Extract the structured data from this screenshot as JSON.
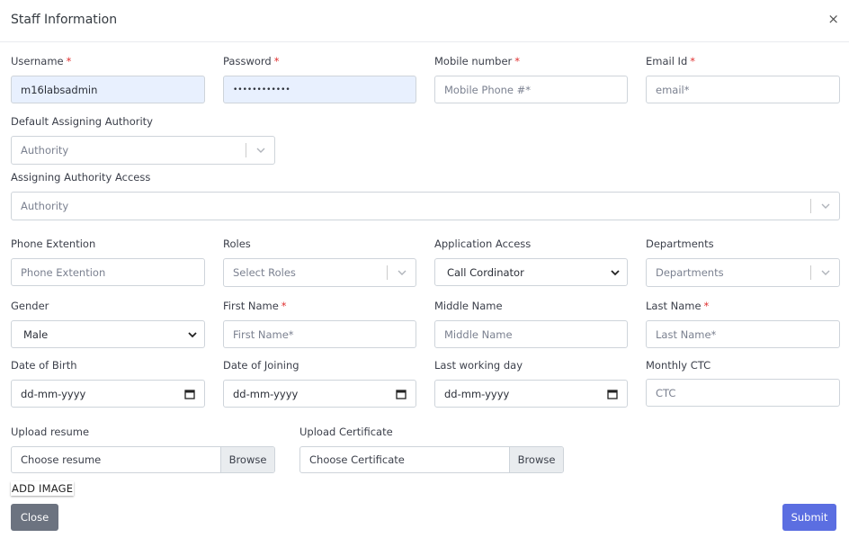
{
  "modal": {
    "title": "Staff Information",
    "close_glyph": "×"
  },
  "fields": {
    "username": {
      "label": "Username",
      "value": "m16labsadmin"
    },
    "password": {
      "label": "Password",
      "value": "••••••••••••"
    },
    "mobile": {
      "label": "Mobile number",
      "placeholder": "Mobile Phone #*"
    },
    "email": {
      "label": "Email Id",
      "placeholder": "email*"
    },
    "default_authority": {
      "label": "Default Assigning Authority",
      "placeholder": "Authority"
    },
    "authority_access": {
      "label": "Assigning Authority Access",
      "placeholder": "Authority"
    },
    "phone_ext": {
      "label": "Phone Extention",
      "placeholder": "Phone Extention"
    },
    "roles": {
      "label": "Roles",
      "placeholder": "Select Roles"
    },
    "app_access": {
      "label": "Application Access",
      "value": "Call Cordinator"
    },
    "departments": {
      "label": "Departments",
      "placeholder": "Departments"
    },
    "gender": {
      "label": "Gender",
      "value": "Male"
    },
    "first_name": {
      "label": "First Name",
      "placeholder": "First Name*"
    },
    "middle_name": {
      "label": "Middle Name",
      "placeholder": "Middle Name"
    },
    "last_name": {
      "label": "Last Name",
      "placeholder": "Last Name*"
    },
    "dob": {
      "label": "Date of Birth",
      "placeholder": "dd-mm-yyyy"
    },
    "doj": {
      "label": "Date of Joining",
      "placeholder": "dd-mm-yyyy"
    },
    "last_day": {
      "label": "Last working day",
      "placeholder": "dd-mm-yyyy"
    },
    "ctc": {
      "label": "Monthly CTC",
      "placeholder": "CTC"
    },
    "resume": {
      "label": "Upload resume",
      "placeholder": "Choose resume",
      "browse": "Browse"
    },
    "certificate": {
      "label": "Upload Certificate",
      "placeholder": "Choose Certificate",
      "browse": "Browse"
    }
  },
  "required_marker": "*",
  "add_image_label": "ADD IMAGE",
  "buttons": {
    "close": "Close",
    "submit": "Submit"
  },
  "colors": {
    "submit": "#5b6ee1",
    "close": "#6c7380",
    "required": "#e03131",
    "autofill": "#e8f0fe"
  }
}
